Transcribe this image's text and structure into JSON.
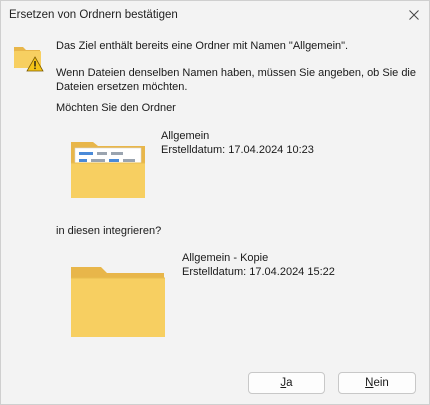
{
  "window": {
    "title": "Ersetzen von Ordnern bestätigen",
    "close_icon": "close-icon"
  },
  "message": {
    "main": "Das Ziel enthält bereits eine Ordner mit Namen \"Allgemein\".",
    "detail_line1": "Wenn Dateien denselben Namen haben, müssen Sie angeben, ob Sie die",
    "detail_line2": "Dateien ersetzen möchten.",
    "question": "Möchten Sie den Ordner",
    "merge_question": "in diesen integrieren?"
  },
  "source_folder": {
    "name": "Allgemein",
    "created": "Erstelldatum: 17.04.2024 10:23",
    "icon": "folder-with-files-icon"
  },
  "target_folder": {
    "name": "Allgemein - Kopie",
    "created": "Erstelldatum: 17.04.2024 15:22",
    "icon": "empty-folder-icon"
  },
  "buttons": {
    "yes_mnemonic": "J",
    "yes_rest": "a",
    "no_mnemonic": "N",
    "no_rest": "ein"
  },
  "colors": {
    "folder_back": "#e8b64a",
    "folder_front": "#f7cf61",
    "warning": "#f5c417"
  }
}
